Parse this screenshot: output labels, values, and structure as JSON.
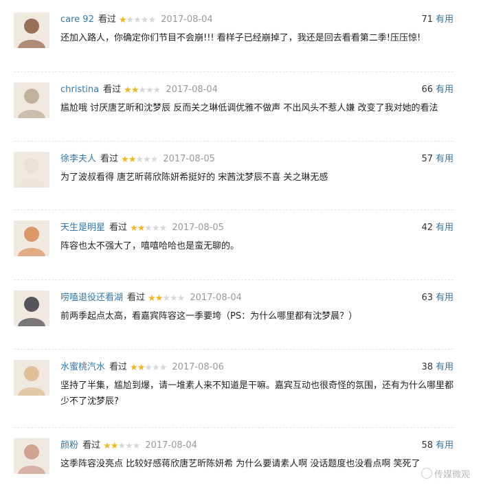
{
  "reviews": [
    {
      "user": "care 92",
      "status": "看过",
      "rating": 1,
      "date": "2017-08-04",
      "text": "还加入路人，你确定你们节目不会崩!!! 看样子已经崩掉了，我还是回去看看第二季!压压惊!",
      "votes": "71",
      "useful": "有用",
      "avatar_color": "#8a5a3c"
    },
    {
      "user": "christina",
      "status": "看过",
      "rating": 2,
      "date": "2017-08-04",
      "text": "尴尬哦 讨厌唐艺昕和沈梦辰 反而关之琳低调优雅不做声 不出风头不惹人嫌 改变了我对她的看法",
      "votes": "66",
      "useful": "有用",
      "avatar_color": "#b9a88f"
    },
    {
      "user": "徐李夫人",
      "status": "看过",
      "rating": 2,
      "date": "2017-08-05",
      "text": "为了波叔看得 唐艺昕蒋欣陈妍希挺好的 宋茜沈梦辰不喜 关之琳无感",
      "votes": "57",
      "useful": "有用",
      "avatar_color": "#e8e2d2"
    },
    {
      "user": "天生是明星",
      "status": "看过",
      "rating": 2,
      "date": "2017-08-05",
      "text": "阵容也太不强大了，嘻嘻哈哈也是蛮无聊的。",
      "votes": "42",
      "useful": "有用",
      "avatar_color": "#d98a55"
    },
    {
      "user": "唠嗑退役还看湖",
      "status": "看过",
      "rating": 2,
      "date": "2017-08-04",
      "text": "前两季起点太高，看嘉宾阵容这一季要垮（PS：为什么哪里都有沈梦晨？）",
      "votes": "63",
      "useful": "有用",
      "avatar_color": "#3a3a44"
    },
    {
      "user": "水蜜桃汽水",
      "status": "看过",
      "rating": 2,
      "date": "2017-08-06",
      "text": "坚持了半集，尴尬到爆，请一堆素人来不知道是干嘛。嘉宾互动也很奇怪的氛围，还有为什么哪里都少不了沈梦辰?",
      "votes": "38",
      "useful": "有用",
      "avatar_color": "#d9b98a"
    },
    {
      "user": "颜粉",
      "status": "看过",
      "rating": 2,
      "date": "2017-08-04",
      "text": "这季阵容没亮点 比较好感蒋欣唐艺昕陈妍希 为什么要请素人啊 没话题度也没看点啊 笑死了",
      "votes": "58",
      "useful": "有用",
      "avatar_color": "#c99582"
    }
  ],
  "watermark": "传媒微观"
}
